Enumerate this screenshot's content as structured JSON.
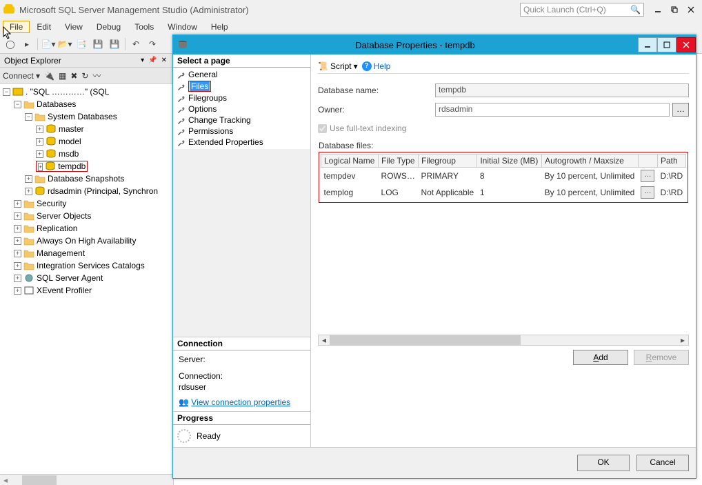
{
  "app": {
    "title": "Microsoft SQL Server Management Studio (Administrator)",
    "quick_launch_placeholder": "Quick Launch (Ctrl+Q)"
  },
  "menu": {
    "file": "File",
    "edit": "Edit",
    "view": "View",
    "debug": "Debug",
    "tools": "Tools",
    "window": "Window",
    "help": "Help"
  },
  "objexp": {
    "title": "Object Explorer",
    "connect_label": "Connect",
    "root": ". \"SQL …………\" (SQL",
    "databases": "Databases",
    "system_db": "System Databases",
    "master": "master",
    "model": "model",
    "msdb": "msdb",
    "tempdb": "tempdb",
    "snapshots": "Database Snapshots",
    "rdsadmin": "rdsadmin (Principal, Synchron",
    "security": "Security",
    "server_objects": "Server Objects",
    "replication": "Replication",
    "always_on": "Always On High Availability",
    "management": "Management",
    "isc": "Integration Services Catalogs",
    "agent": "SQL Server Agent",
    "xevent": "XEvent Profiler"
  },
  "dialog": {
    "title": "Database Properties - tempdb",
    "select_page": "Select a page",
    "pages": {
      "general": "General",
      "files": "Files",
      "filegroups": "Filegroups",
      "options": "Options",
      "change_tracking": "Change Tracking",
      "permissions": "Permissions",
      "extended": "Extended Properties"
    },
    "connection_hd": "Connection",
    "server_label": "Server:",
    "server_value": "",
    "connection_label": "Connection:",
    "connection_value": "rdsuser",
    "view_conn": "View connection properties",
    "progress_hd": "Progress",
    "progress_status": "Ready",
    "script_label": "Script",
    "help_label": "Help",
    "dbname_label": "Database name:",
    "dbname_value": "tempdb",
    "owner_label": "Owner:",
    "owner_value": "rdsadmin",
    "fulltext_label": "Use full-text indexing",
    "files_legend": "Database files:",
    "cols": {
      "logical": "Logical Name",
      "filetype": "File Type",
      "filegroup": "Filegroup",
      "initsize": "Initial Size (MB)",
      "autogrowth": "Autogrowth / Maxsize",
      "path": "Path"
    },
    "rows": [
      {
        "logical": "tempdev",
        "filetype": "ROWS…",
        "filegroup": "PRIMARY",
        "initsize": "8",
        "autogrowth": "By 10 percent, Unlimited",
        "path": "D:\\RD"
      },
      {
        "logical": "templog",
        "filetype": "LOG",
        "filegroup": "Not Applicable",
        "initsize": "1",
        "autogrowth": "By 10 percent, Unlimited",
        "path": "D:\\RD"
      }
    ],
    "add_btn": "Add",
    "remove_btn": "Remove",
    "ok_btn": "OK",
    "cancel_btn": "Cancel"
  }
}
